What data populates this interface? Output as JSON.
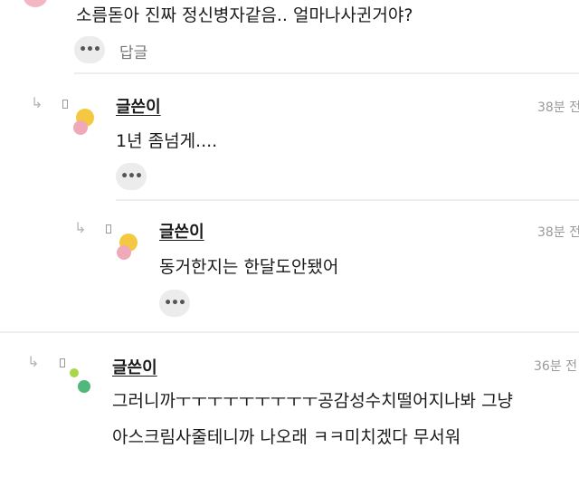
{
  "top_comment": {
    "text": "소름돋아 진짜 정신병자같음.. 얼마나사귄거야?",
    "reply_label": "답글",
    "more_label": "•••"
  },
  "replies": [
    {
      "author": "글쓴이",
      "time": "38분 전",
      "text": "1년 좀넘게....",
      "more_label": "•••",
      "avatar_colors": [
        "#f5c842",
        "#f0a9b8"
      ]
    },
    {
      "author": "글쓴이",
      "time": "38분 전",
      "text": "동거한지는 한달도안됐어",
      "more_label": "•••",
      "avatar_colors": [
        "#f5c842",
        "#f0a9b8"
      ]
    },
    {
      "author": "글쓴이",
      "time": "36분 전",
      "lines": [
        "그러니까ㅜㅜㅜㅜㅜㅜㅜㅜㅜ공감성수치떨어지나봐 그냥",
        "아스크림사줄테니까 나오래 ㅋㅋ미치겠다 무서워"
      ],
      "avatar_colors": [
        "#a8d84a",
        "#4fb87a"
      ]
    }
  ]
}
